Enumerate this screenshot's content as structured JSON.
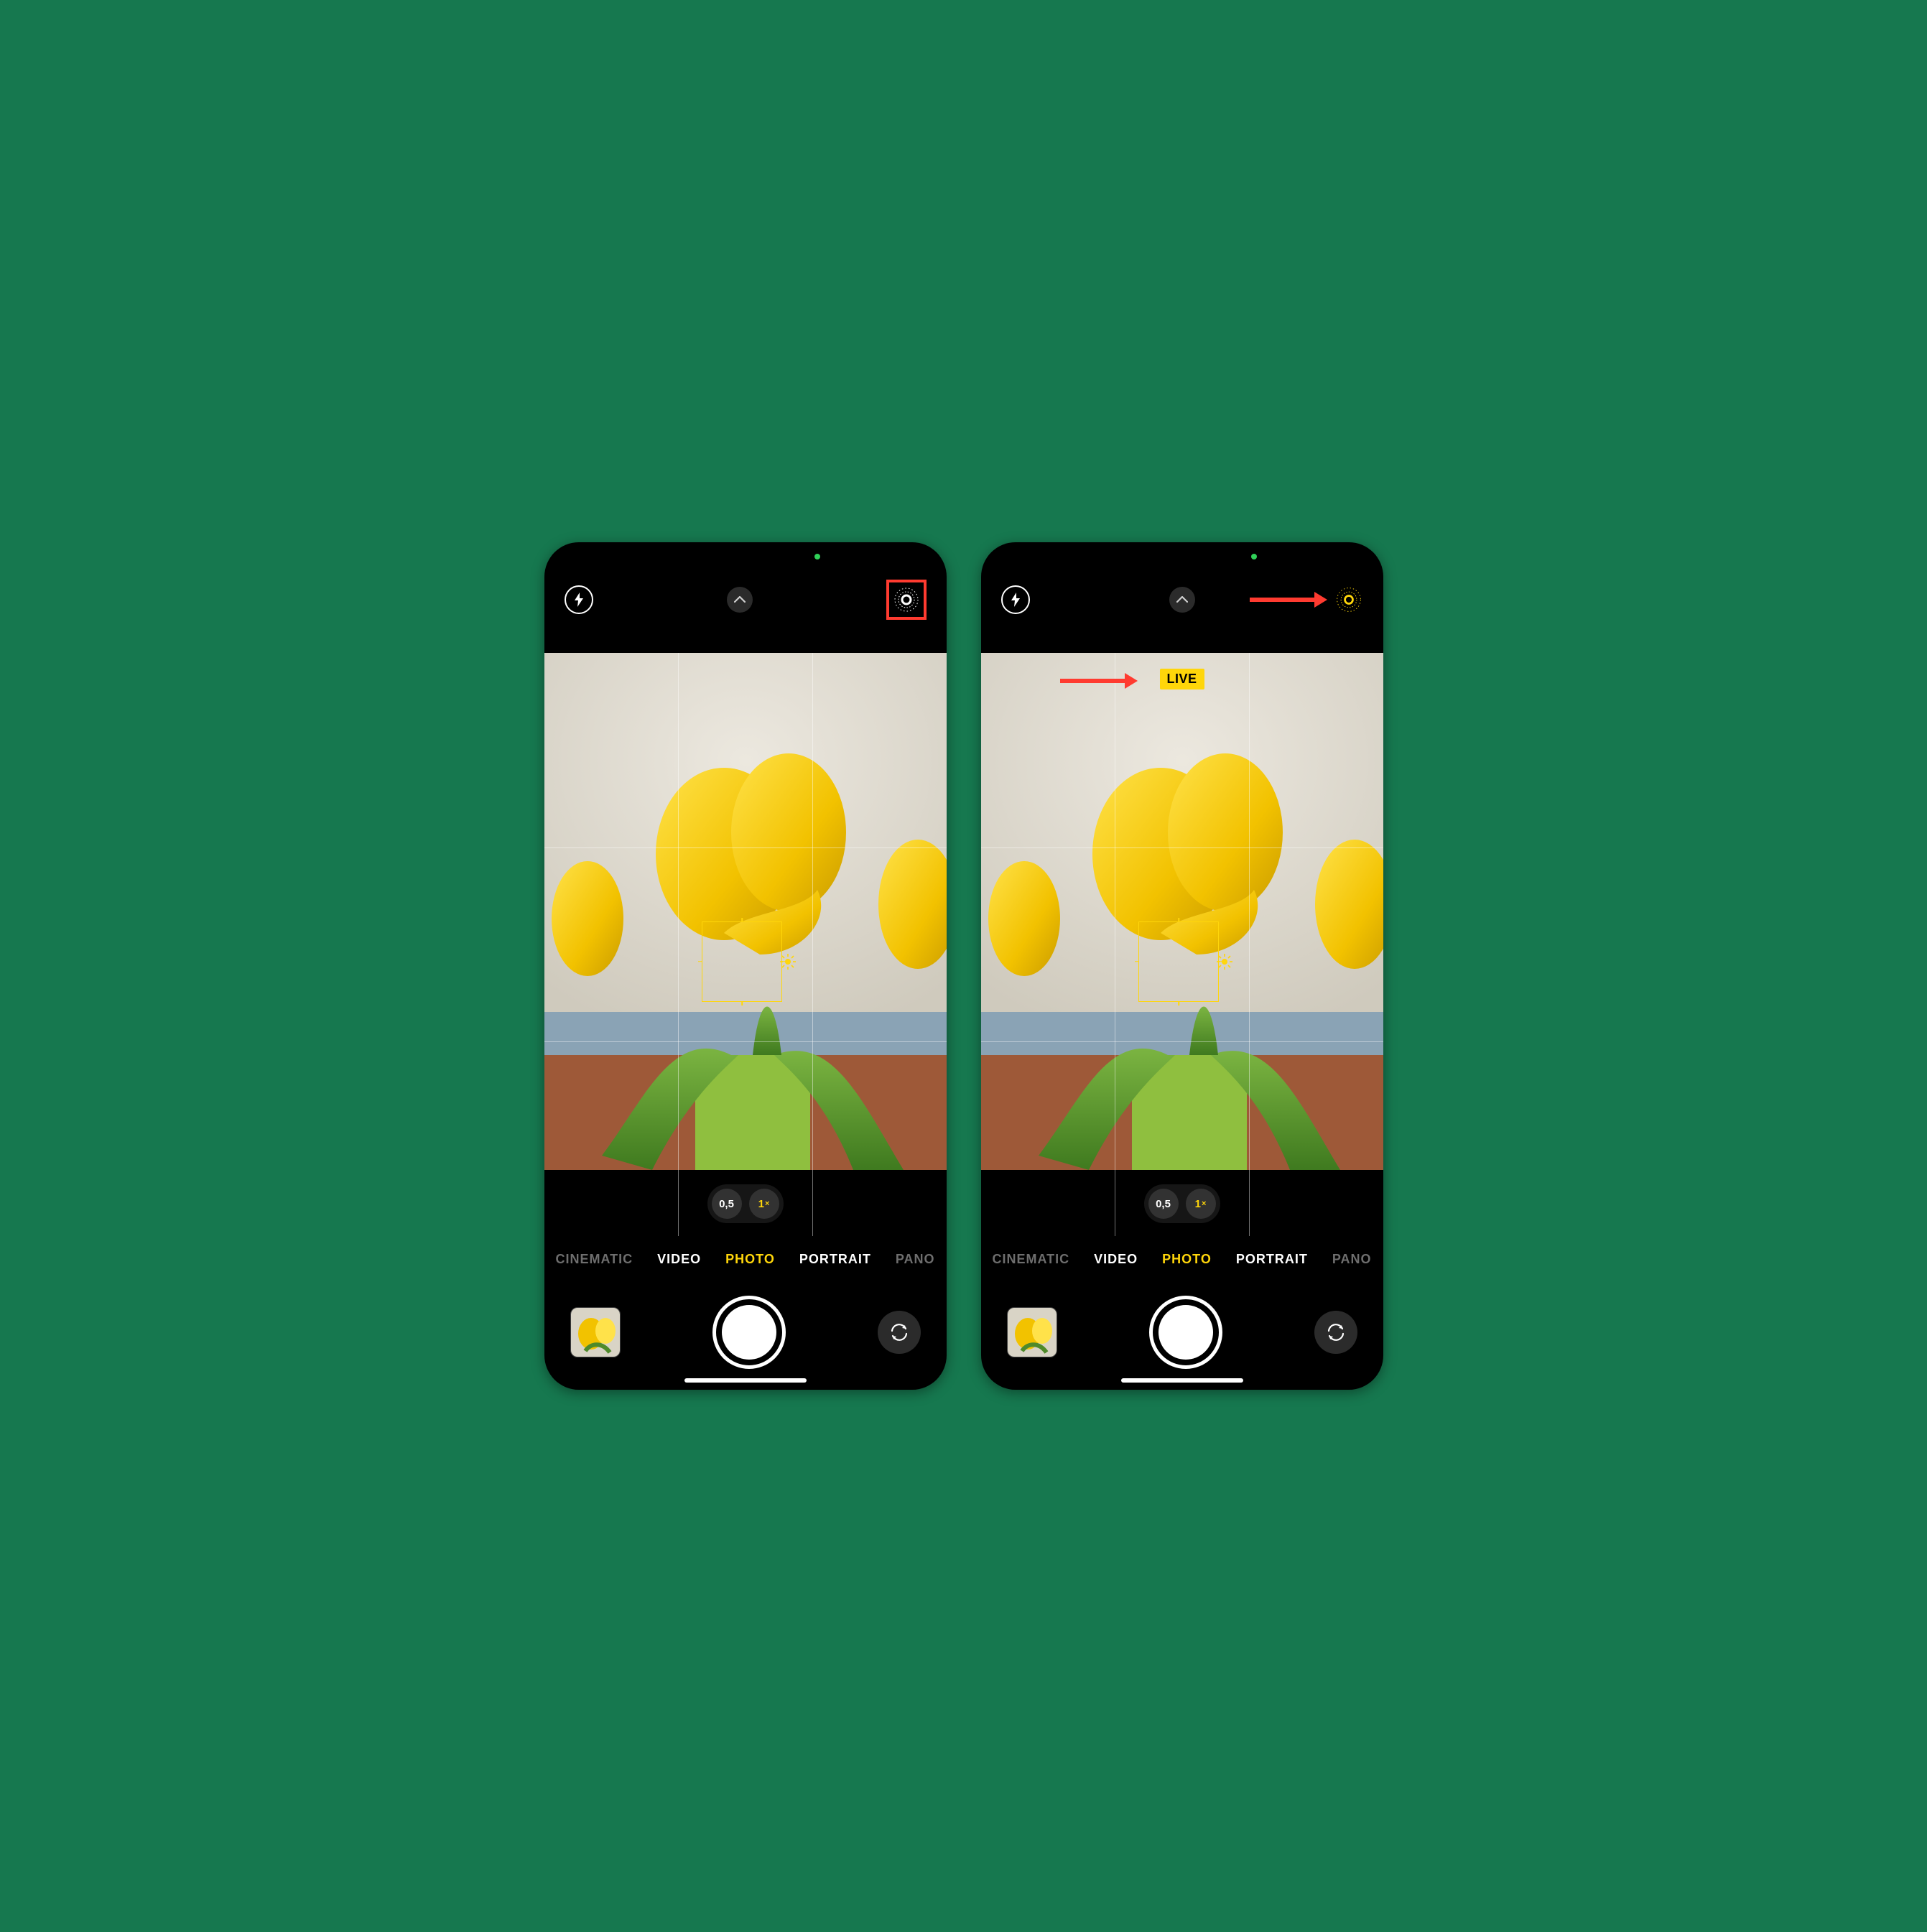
{
  "left": {
    "live_photo_active": false,
    "zoom": {
      "wide": "0,5",
      "main": "1",
      "main_suffix": "×"
    },
    "modes": [
      "CINEMATIC",
      "VIDEO",
      "PHOTO",
      "PORTRAIT",
      "PANO"
    ],
    "active_mode_index": 2
  },
  "right": {
    "live_photo_active": true,
    "live_label": "LIVE",
    "zoom": {
      "wide": "0,5",
      "main": "1",
      "main_suffix": "×"
    },
    "modes": [
      "CINEMATIC",
      "VIDEO",
      "PHOTO",
      "PORTRAIT",
      "PANO"
    ],
    "active_mode_index": 2
  },
  "colors": {
    "accent": "#ffd60a",
    "annotation": "#ff3b30"
  }
}
